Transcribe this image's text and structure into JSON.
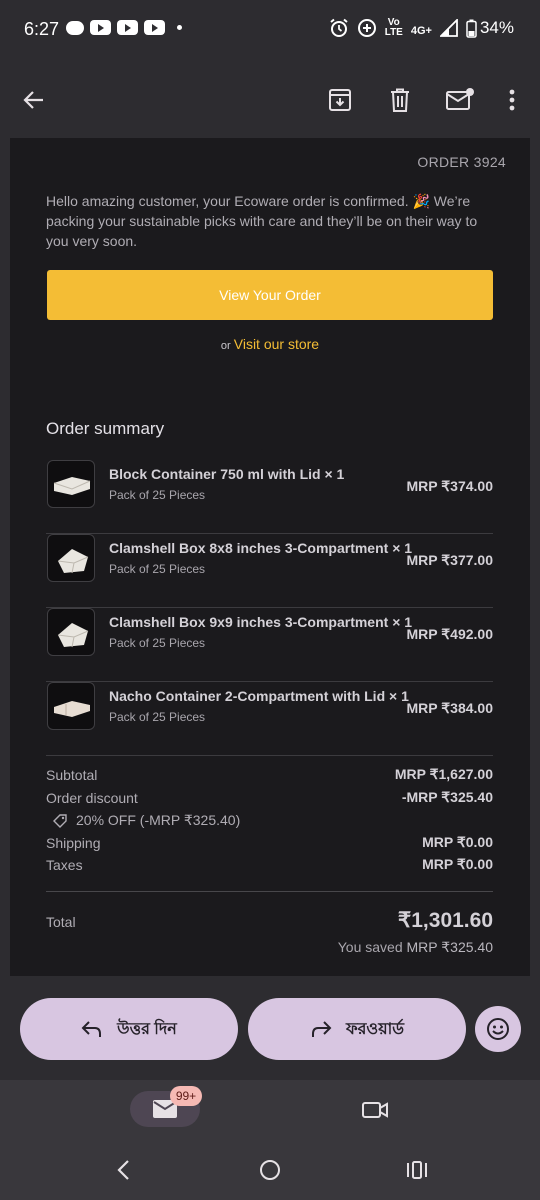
{
  "status_bar": {
    "time": "6:27",
    "network_top": "Vo",
    "network_mid": "LTE",
    "network_type": "4G+",
    "battery": "34%"
  },
  "toolbar": {
    "icons": [
      "back-arrow-icon",
      "archive-icon",
      "delete-icon",
      "mark-unread-icon",
      "more-vert-icon"
    ]
  },
  "email": {
    "order_number": "ORDER 3924",
    "intro": "Hello amazing customer, your Ecoware order is confirmed. 🎉 We’re packing your sustainable picks with care and they’ll be on their way to you very soon.",
    "cta_label": "View Your Order",
    "or_text": "or",
    "visit_store": "Visit our store",
    "summary_title": "Order summary",
    "items": [
      {
        "name": "Block Container 750 ml with Lid × 1",
        "sub": "Pack of 25 Pieces",
        "price": "MRP ₹374.00"
      },
      {
        "name": "Clamshell Box 8x8 inches 3-Compartment × 1",
        "sub": "Pack of 25 Pieces",
        "price": "MRP ₹377.00"
      },
      {
        "name": "Clamshell Box 9x9 inches 3-Compartment × 1",
        "sub": "Pack of 25 Pieces",
        "price": "MRP ₹492.00"
      },
      {
        "name": "Nacho Container 2-Compartment with Lid × 1",
        "sub": "Pack of 25 Pieces",
        "price": "MRP ₹384.00"
      }
    ],
    "subtotal_label": "Subtotal",
    "subtotal_value": "MRP ₹1,627.00",
    "discount_label": "Order discount",
    "discount_value": "-MRP ₹325.40",
    "discount_code": "20% OFF (-MRP ₹325.40)",
    "shipping_label": "Shipping",
    "shipping_value": "MRP ₹0.00",
    "taxes_label": "Taxes",
    "taxes_value": "MRP ₹0.00",
    "total_label": "Total",
    "total_value": "₹1,301.60",
    "saved_text": "You saved",
    "saved_value": "MRP ₹325.40"
  },
  "actions": {
    "reply_label": "উত্তর দিন",
    "forward_label": "ফরওয়ার্ড"
  },
  "bottom_nav": {
    "mail_badge": "99+"
  },
  "colors": {
    "accent": "#f4bd35",
    "pill": "#d8c6e1",
    "card_bg": "#1b1a1d",
    "chrome_bg": "#2d2c30"
  }
}
